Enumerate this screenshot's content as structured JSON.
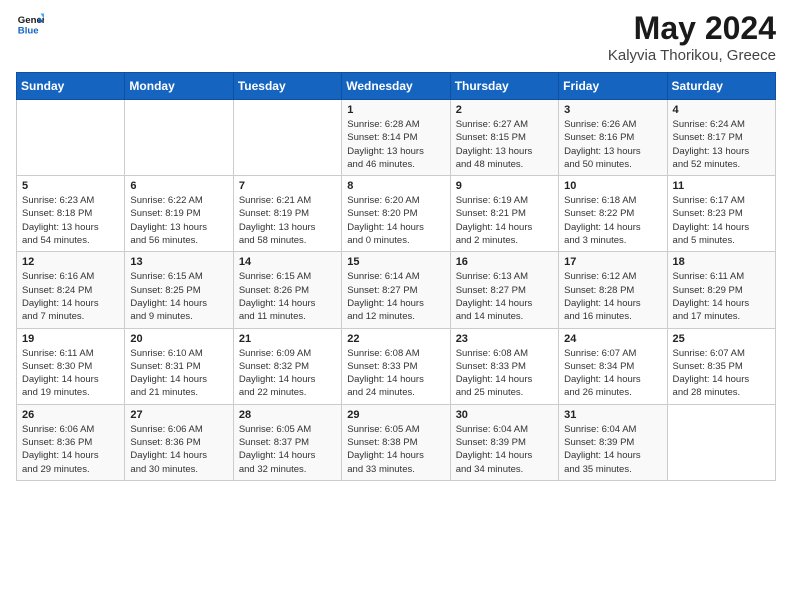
{
  "header": {
    "logo_line1": "General",
    "logo_line2": "Blue",
    "title": "May 2024",
    "subtitle": "Kalyvia Thorikou, Greece"
  },
  "days_of_week": [
    "Sunday",
    "Monday",
    "Tuesday",
    "Wednesday",
    "Thursday",
    "Friday",
    "Saturday"
  ],
  "weeks": [
    [
      {
        "day": "",
        "info": ""
      },
      {
        "day": "",
        "info": ""
      },
      {
        "day": "",
        "info": ""
      },
      {
        "day": "1",
        "info": "Sunrise: 6:28 AM\nSunset: 8:14 PM\nDaylight: 13 hours\nand 46 minutes."
      },
      {
        "day": "2",
        "info": "Sunrise: 6:27 AM\nSunset: 8:15 PM\nDaylight: 13 hours\nand 48 minutes."
      },
      {
        "day": "3",
        "info": "Sunrise: 6:26 AM\nSunset: 8:16 PM\nDaylight: 13 hours\nand 50 minutes."
      },
      {
        "day": "4",
        "info": "Sunrise: 6:24 AM\nSunset: 8:17 PM\nDaylight: 13 hours\nand 52 minutes."
      }
    ],
    [
      {
        "day": "5",
        "info": "Sunrise: 6:23 AM\nSunset: 8:18 PM\nDaylight: 13 hours\nand 54 minutes."
      },
      {
        "day": "6",
        "info": "Sunrise: 6:22 AM\nSunset: 8:19 PM\nDaylight: 13 hours\nand 56 minutes."
      },
      {
        "day": "7",
        "info": "Sunrise: 6:21 AM\nSunset: 8:19 PM\nDaylight: 13 hours\nand 58 minutes."
      },
      {
        "day": "8",
        "info": "Sunrise: 6:20 AM\nSunset: 8:20 PM\nDaylight: 14 hours\nand 0 minutes."
      },
      {
        "day": "9",
        "info": "Sunrise: 6:19 AM\nSunset: 8:21 PM\nDaylight: 14 hours\nand 2 minutes."
      },
      {
        "day": "10",
        "info": "Sunrise: 6:18 AM\nSunset: 8:22 PM\nDaylight: 14 hours\nand 3 minutes."
      },
      {
        "day": "11",
        "info": "Sunrise: 6:17 AM\nSunset: 8:23 PM\nDaylight: 14 hours\nand 5 minutes."
      }
    ],
    [
      {
        "day": "12",
        "info": "Sunrise: 6:16 AM\nSunset: 8:24 PM\nDaylight: 14 hours\nand 7 minutes."
      },
      {
        "day": "13",
        "info": "Sunrise: 6:15 AM\nSunset: 8:25 PM\nDaylight: 14 hours\nand 9 minutes."
      },
      {
        "day": "14",
        "info": "Sunrise: 6:15 AM\nSunset: 8:26 PM\nDaylight: 14 hours\nand 11 minutes."
      },
      {
        "day": "15",
        "info": "Sunrise: 6:14 AM\nSunset: 8:27 PM\nDaylight: 14 hours\nand 12 minutes."
      },
      {
        "day": "16",
        "info": "Sunrise: 6:13 AM\nSunset: 8:27 PM\nDaylight: 14 hours\nand 14 minutes."
      },
      {
        "day": "17",
        "info": "Sunrise: 6:12 AM\nSunset: 8:28 PM\nDaylight: 14 hours\nand 16 minutes."
      },
      {
        "day": "18",
        "info": "Sunrise: 6:11 AM\nSunset: 8:29 PM\nDaylight: 14 hours\nand 17 minutes."
      }
    ],
    [
      {
        "day": "19",
        "info": "Sunrise: 6:11 AM\nSunset: 8:30 PM\nDaylight: 14 hours\nand 19 minutes."
      },
      {
        "day": "20",
        "info": "Sunrise: 6:10 AM\nSunset: 8:31 PM\nDaylight: 14 hours\nand 21 minutes."
      },
      {
        "day": "21",
        "info": "Sunrise: 6:09 AM\nSunset: 8:32 PM\nDaylight: 14 hours\nand 22 minutes."
      },
      {
        "day": "22",
        "info": "Sunrise: 6:08 AM\nSunset: 8:33 PM\nDaylight: 14 hours\nand 24 minutes."
      },
      {
        "day": "23",
        "info": "Sunrise: 6:08 AM\nSunset: 8:33 PM\nDaylight: 14 hours\nand 25 minutes."
      },
      {
        "day": "24",
        "info": "Sunrise: 6:07 AM\nSunset: 8:34 PM\nDaylight: 14 hours\nand 26 minutes."
      },
      {
        "day": "25",
        "info": "Sunrise: 6:07 AM\nSunset: 8:35 PM\nDaylight: 14 hours\nand 28 minutes."
      }
    ],
    [
      {
        "day": "26",
        "info": "Sunrise: 6:06 AM\nSunset: 8:36 PM\nDaylight: 14 hours\nand 29 minutes."
      },
      {
        "day": "27",
        "info": "Sunrise: 6:06 AM\nSunset: 8:36 PM\nDaylight: 14 hours\nand 30 minutes."
      },
      {
        "day": "28",
        "info": "Sunrise: 6:05 AM\nSunset: 8:37 PM\nDaylight: 14 hours\nand 32 minutes."
      },
      {
        "day": "29",
        "info": "Sunrise: 6:05 AM\nSunset: 8:38 PM\nDaylight: 14 hours\nand 33 minutes."
      },
      {
        "day": "30",
        "info": "Sunrise: 6:04 AM\nSunset: 8:39 PM\nDaylight: 14 hours\nand 34 minutes."
      },
      {
        "day": "31",
        "info": "Sunrise: 6:04 AM\nSunset: 8:39 PM\nDaylight: 14 hours\nand 35 minutes."
      },
      {
        "day": "",
        "info": ""
      }
    ]
  ]
}
